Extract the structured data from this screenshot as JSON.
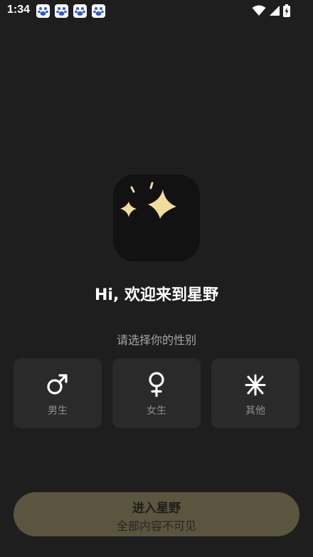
{
  "status_bar": {
    "time": "1:34",
    "notification_icons": [
      "baidu-paw-icon",
      "baidu-paw-icon",
      "baidu-paw-icon",
      "baidu-paw-icon"
    ],
    "system_icons": [
      "wifi-icon",
      "signal-icon",
      "battery-charging-icon"
    ]
  },
  "logo": {
    "icon": "sparkle-stars-icon",
    "star_color": "#f2dc9a",
    "background": "#121212"
  },
  "welcome": {
    "title": "Hi, 欢迎来到星野"
  },
  "gender": {
    "prompt": "请选择你的性别",
    "options": [
      {
        "label": "男生",
        "icon": "male-symbol-icon"
      },
      {
        "label": "女生",
        "icon": "female-symbol-icon"
      },
      {
        "label": "其他",
        "icon": "asterisk-gender-icon"
      }
    ]
  },
  "enter_button": {
    "title": "进入星野",
    "subtitle": "全部内容不可见",
    "color": "#5b543f"
  },
  "colors": {
    "background": "#1e1e1e",
    "card": "#2a2a2a",
    "accent": "#f2dc9a"
  }
}
